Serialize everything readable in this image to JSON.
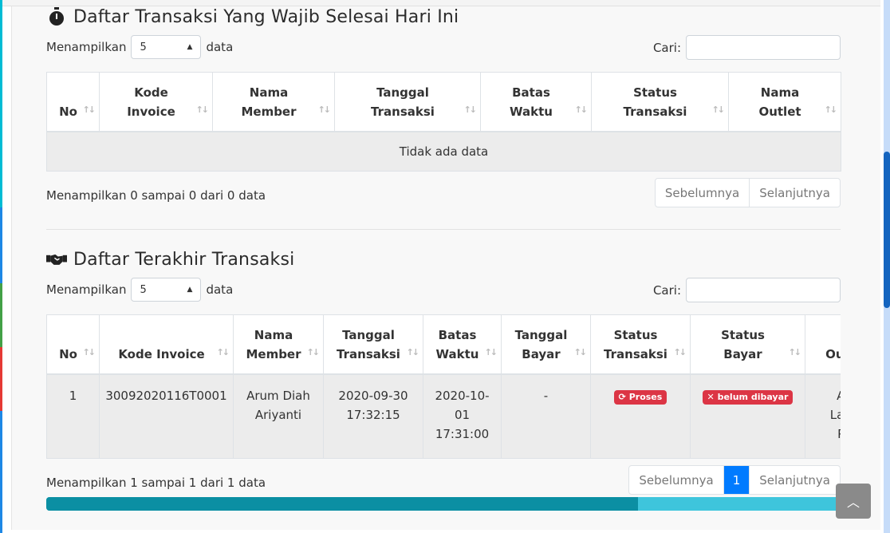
{
  "colors": {
    "accent": "#007bff",
    "danger": "#dc3545",
    "progress_track": "#3ec5dc",
    "progress_fill": "#0b8fa3"
  },
  "section1": {
    "title": "Daftar Transaksi Yang Wajib Selesai Hari Ini",
    "icon": "stopwatch-icon",
    "length_prefix": "Menampilkan",
    "length_value": "5",
    "length_suffix": "data",
    "search_label": "Cari:",
    "columns": [
      [
        "No"
      ],
      [
        "Kode",
        "Invoice"
      ],
      [
        "Nama",
        "Member"
      ],
      [
        "Tanggal",
        "Transaksi"
      ],
      [
        "Batas",
        "Waktu"
      ],
      [
        "Status",
        "Transaksi"
      ],
      [
        "Nama",
        "Outlet"
      ]
    ],
    "empty_text": "Tidak ada data",
    "info": "Menampilkan 0 sampai 0 dari 0 data",
    "prev": "Sebelumnya",
    "next": "Selanjutnya"
  },
  "section2": {
    "title": "Daftar Terakhir Transaksi",
    "icon": "handshake-icon",
    "length_prefix": "Menampilkan",
    "length_value": "5",
    "length_suffix": "data",
    "search_label": "Cari:",
    "columns": [
      [
        "No"
      ],
      [
        "Kode Invoice"
      ],
      [
        "Nama",
        "Member"
      ],
      [
        "Tanggal",
        "Transaksi"
      ],
      [
        "Batas",
        "Waktu"
      ],
      [
        "Tanggal",
        "Bayar"
      ],
      [
        "Status",
        "Transaksi"
      ],
      [
        "Status",
        "Bayar"
      ],
      [
        "Outl"
      ]
    ],
    "rows": [
      {
        "no": "1",
        "kode_invoice": "30092020116T0001",
        "nama_member": [
          "Arum Diah",
          "Ariyanti"
        ],
        "tanggal_transaksi": [
          "2020-09-30",
          "17:32:15"
        ],
        "batas_waktu": [
          "2020-10-",
          "01",
          "17:31:00"
        ],
        "tanggal_bayar": "-",
        "status_transaksi": "Proses",
        "status_bayar": "belum dibayar",
        "outlet": [
          "An",
          "Laun",
          "Po"
        ]
      }
    ],
    "info": "Menampilkan 1 sampai 1 dari 1 data",
    "prev": "Sebelumnya",
    "page": "1",
    "next": "Selanjutnya"
  },
  "scroll_progress": 0.745,
  "back_to_top_icon": "chevron-up-icon"
}
